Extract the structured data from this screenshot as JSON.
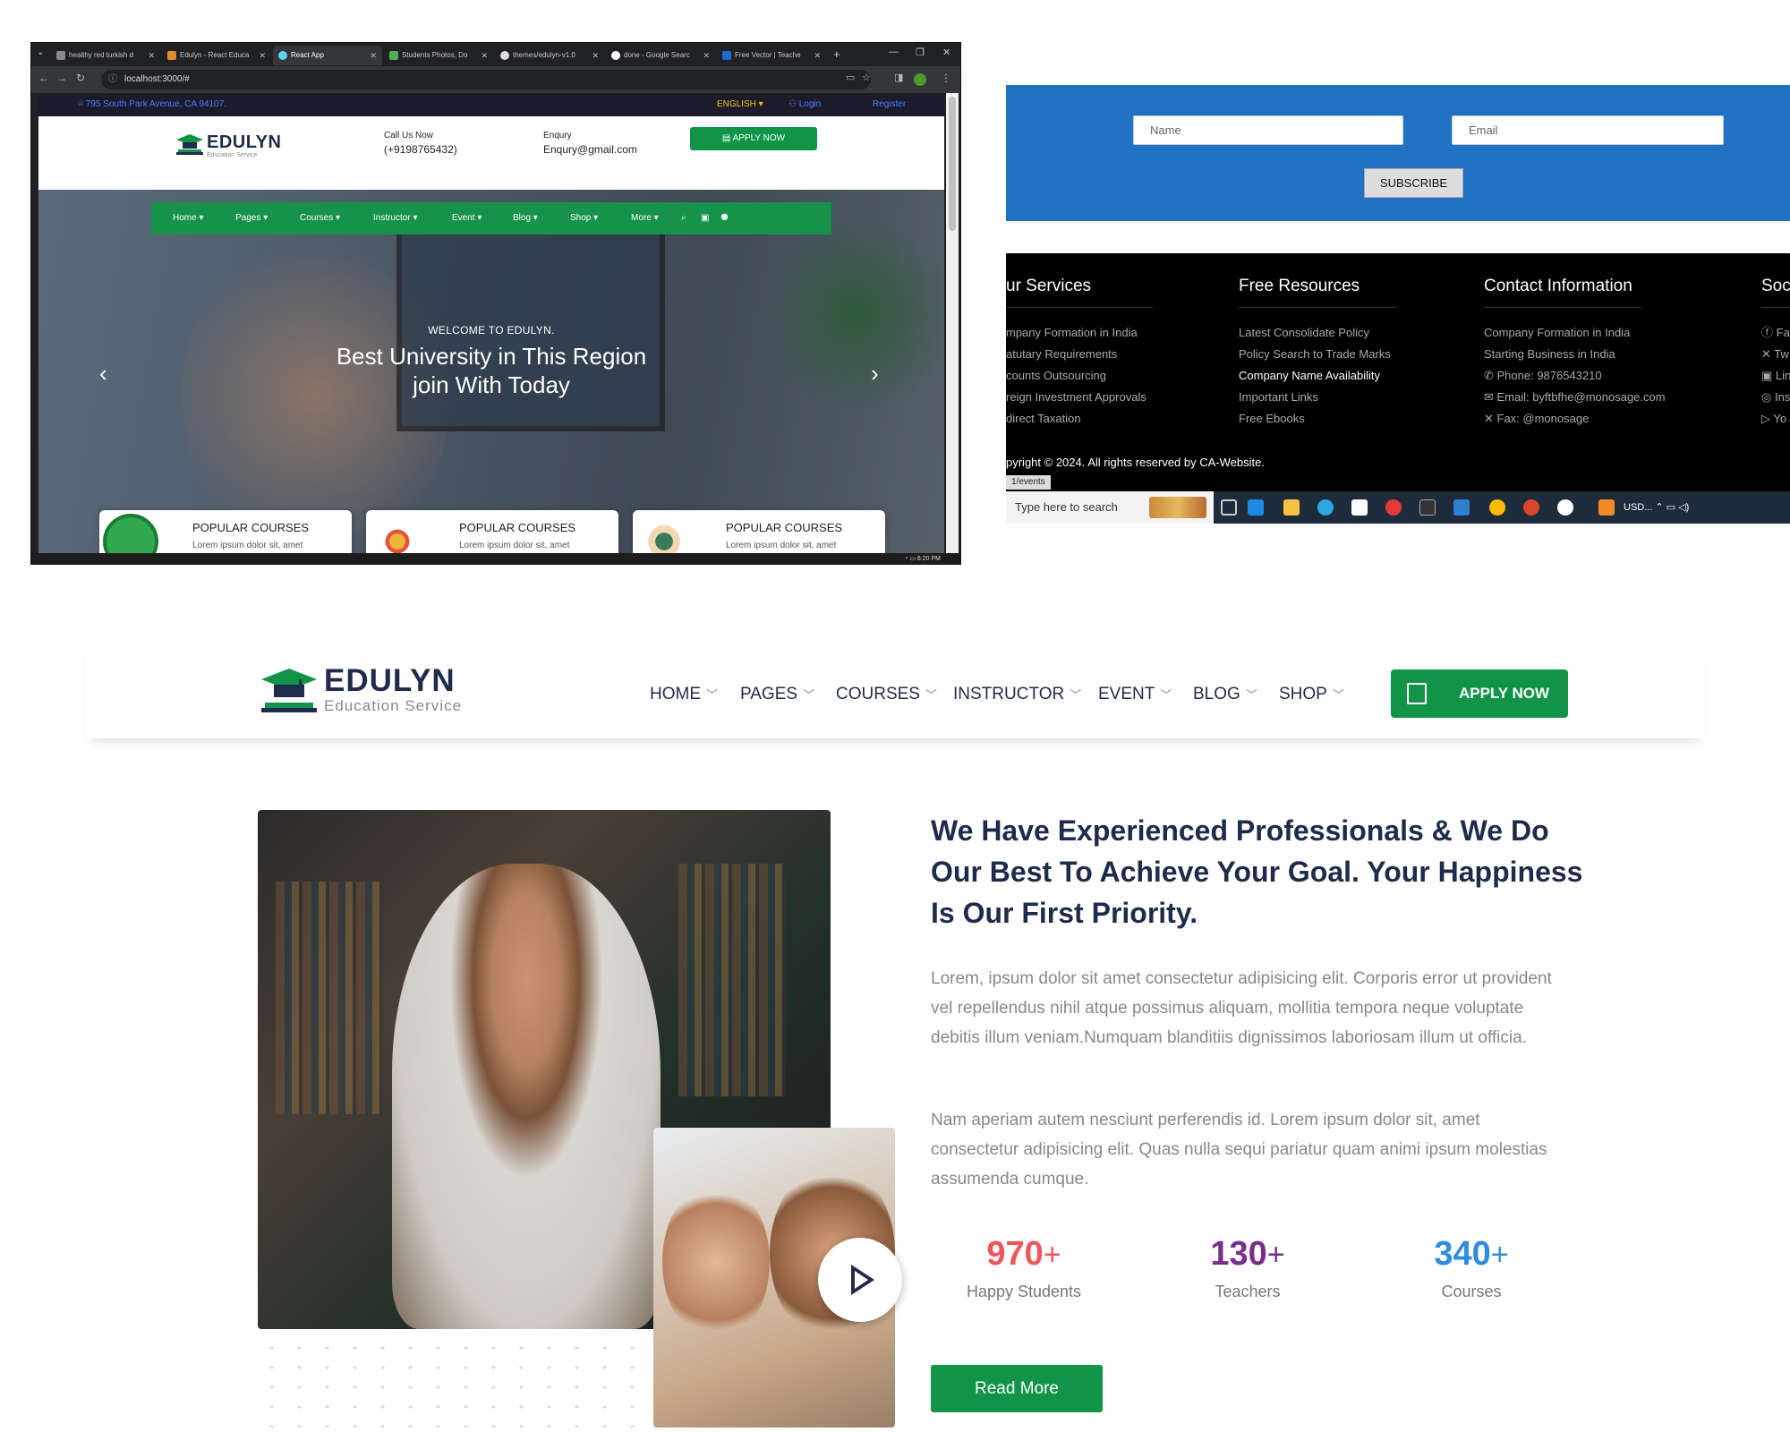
{
  "browser": {
    "tabs": [
      {
        "label": "healthy red turkish d"
      },
      {
        "label": "Edulyn - React Educa"
      },
      {
        "label": "React App"
      },
      {
        "label": "Students Photos, Do"
      },
      {
        "label": "themes/edulyn-v1.0"
      },
      {
        "label": "done - Google Searc"
      },
      {
        "label": "Free Vector | Teache"
      }
    ],
    "new_tab": "+",
    "url": "localhost:3000/#",
    "clock": "6:20 PM"
  },
  "mini_site": {
    "address": "795 South Park Avenue, CA 94107.",
    "language": "ENGLISH",
    "login": "Login",
    "register": "Register",
    "logo_word": "EDULYN",
    "logo_sub": "Education Service",
    "call_label": "Call Us Now",
    "call_value": "(+9198765432)",
    "enquiry_label": "Enqury",
    "enquiry_value": "Enqury@gmail.com",
    "apply": "APPLY NOW",
    "nav": [
      "Home",
      "Pages",
      "Courses",
      "Instructor",
      "Event",
      "Blog",
      "Shop",
      "More"
    ],
    "hero_welcome": "WELCOME TO EDULYN.",
    "hero_line1": "Best University in This Region",
    "hero_line2": "join With Today",
    "course_title": "POPULAR COURSES",
    "course_desc": "Lorem ipsum dolor sit, amet"
  },
  "newsletter": {
    "name_placeholder": "Name",
    "email_placeholder": "Email",
    "subscribe": "SUBSCRIBE"
  },
  "footer": {
    "services": {
      "heading": "ur Services",
      "items": [
        "mpany Formation in India",
        "atutary Requirements",
        "counts Outsourcing",
        "reign Investment Approvals",
        "direct Taxation"
      ]
    },
    "resources": {
      "heading": "Free Resources",
      "items": [
        "Latest Consolidate Policy",
        "Policy Search to Trade Marks",
        "Company Name Availability",
        "Important Links",
        "Free Ebooks"
      ]
    },
    "contact": {
      "heading": "Contact Information",
      "items": [
        "Company Formation in India",
        "Starting Business in India",
        "Phone: 9876543210",
        "Email: byftbfhe@monosage.com",
        "Fax: @monosage"
      ]
    },
    "social": {
      "heading": "Soc",
      "items": [
        "Fa",
        "Tw",
        "Lin",
        "Ins",
        "Yo"
      ]
    },
    "copyright": "pyright © 2024. All rights reserved by CA-Website.",
    "link_status": "1/events"
  },
  "taskbar": {
    "search": "Type here to search",
    "tray": "USD..."
  },
  "main": {
    "logo_word": "EDULYN",
    "logo_sub": "Education Service",
    "nav": [
      "HOME",
      "PAGES",
      "COURSES",
      "INSTRUCTOR",
      "EVENT",
      "BLOG",
      "SHOP"
    ],
    "apply": "APPLY NOW",
    "heading": "We Have Experienced Professionals & We Do Our Best To Achieve Your Goal. Your Happiness Is Our First Priority.",
    "para1": "Lorem, ipsum dolor sit amet consectetur adipisicing elit. Corporis error ut provident vel repellendus nihil atque possimus aliquam, mollitia tempora neque voluptate debitis illum veniam.Numquam blanditiis dignissimos laboriosam illum ut officia.",
    "para2": "Nam aperiam autem nesciunt perferendis id. Lorem ipsum dolor sit, amet consectetur adipisicing elit. Quas nulla sequi pariatur quam animi ipsum molestias assumenda cumque.",
    "stats": [
      {
        "value": "970",
        "suffix": "+",
        "label": "Happy Students",
        "color": "#f0555a"
      },
      {
        "value": "130",
        "suffix": "+",
        "label": "Teachers",
        "color": "#7a2e8c"
      },
      {
        "value": "340",
        "suffix": "+",
        "label": "Courses",
        "color": "#2f8ce0"
      }
    ],
    "read_more": "Read More"
  },
  "colors": {
    "brand_green": "#119447",
    "navy": "#1f2b4a",
    "newsletter_blue": "#1f72c4"
  }
}
